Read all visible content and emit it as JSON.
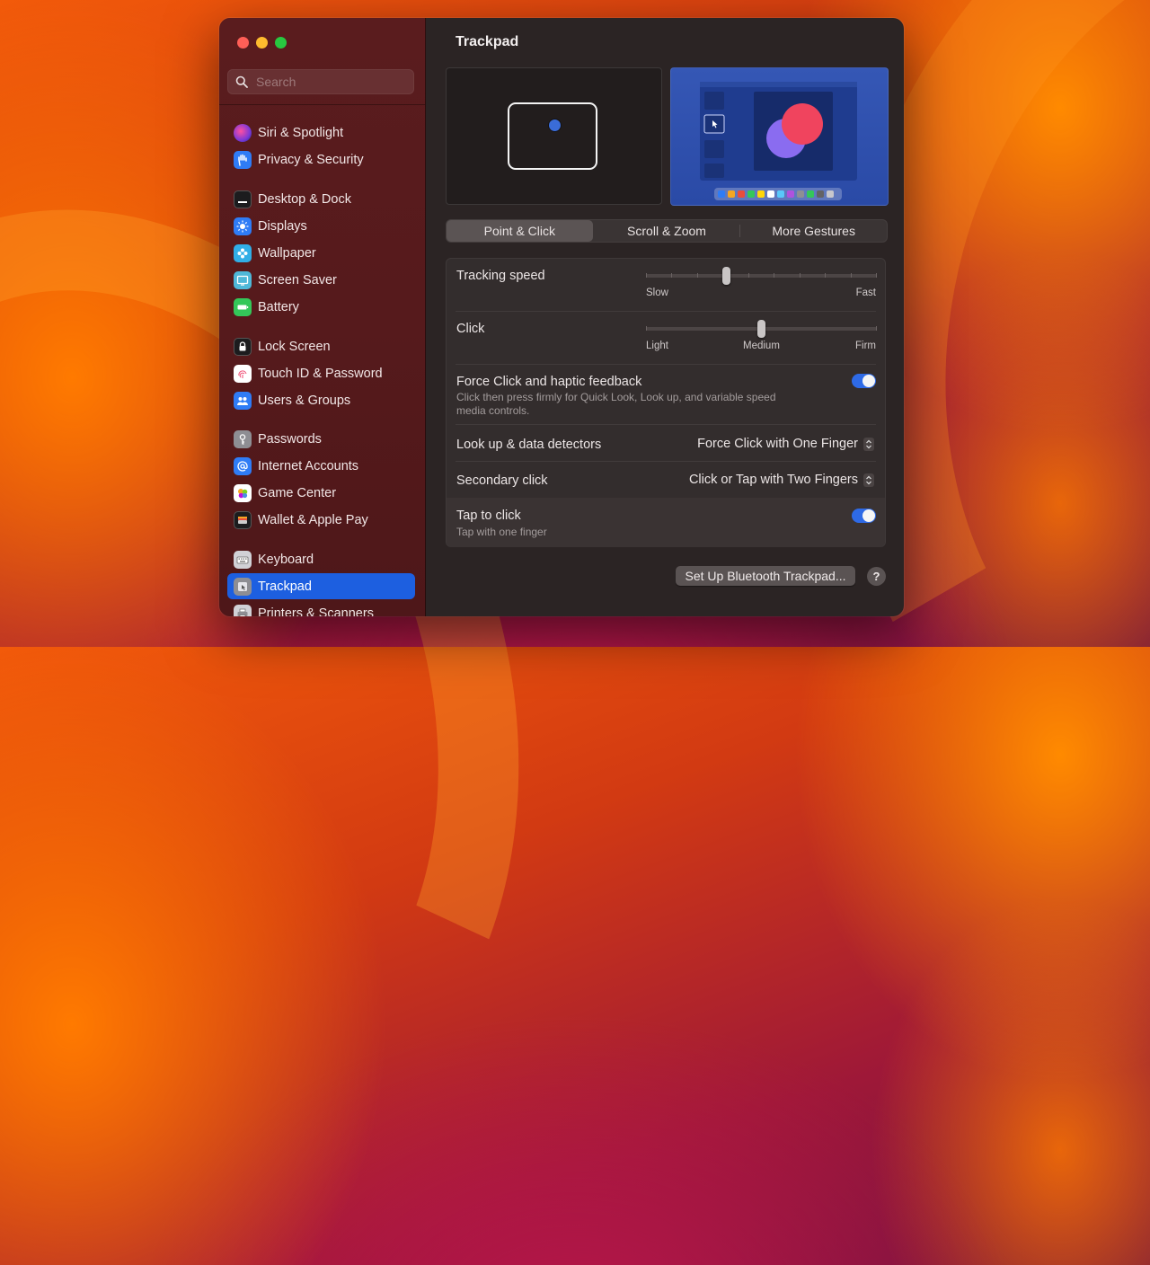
{
  "window": {
    "title": "Trackpad"
  },
  "search": {
    "placeholder": "Search"
  },
  "sidebar": {
    "items": [
      {
        "label": "Siri & Spotlight",
        "icon": "siri-icon",
        "color": "#8a3ab9"
      },
      {
        "label": "Privacy & Security",
        "icon": "hand-icon",
        "color": "#2f7cf6"
      },
      {
        "label": "Desktop & Dock",
        "icon": "dock-icon",
        "color": "#1c1c1e"
      },
      {
        "label": "Displays",
        "icon": "sun-icon",
        "color": "#2f7cf6"
      },
      {
        "label": "Wallpaper",
        "icon": "flower-icon",
        "color": "#31aee6"
      },
      {
        "label": "Screen Saver",
        "icon": "screensaver-icon",
        "color": "#4fb8d8"
      },
      {
        "label": "Battery",
        "icon": "battery-icon",
        "color": "#34c759"
      },
      {
        "label": "Lock Screen",
        "icon": "lock-icon",
        "color": "#1c1c1e"
      },
      {
        "label": "Touch ID & Password",
        "icon": "fingerprint-icon",
        "color": "#f05a7e"
      },
      {
        "label": "Users & Groups",
        "icon": "users-icon",
        "color": "#2f7cf6"
      },
      {
        "label": "Passwords",
        "icon": "key-icon",
        "color": "#8e8e93"
      },
      {
        "label": "Internet Accounts",
        "icon": "at-icon",
        "color": "#2f7cf6"
      },
      {
        "label": "Game Center",
        "icon": "game-center-icon",
        "color": "#ffffff"
      },
      {
        "label": "Wallet & Apple Pay",
        "icon": "wallet-icon",
        "color": "#1c1c1e"
      },
      {
        "label": "Keyboard",
        "icon": "keyboard-icon",
        "color": "#b0b0b5"
      },
      {
        "label": "Trackpad",
        "icon": "trackpad-icon",
        "color": "#8e8e93",
        "active": true
      },
      {
        "label": "Printers & Scanners",
        "icon": "printer-icon",
        "color": "#b0b0b5"
      }
    ]
  },
  "tabs": [
    {
      "label": "Point & Click",
      "active": true
    },
    {
      "label": "Scroll & Zoom"
    },
    {
      "label": "More Gestures"
    }
  ],
  "settings": {
    "tracking_speed": {
      "label": "Tracking speed",
      "min_label": "Slow",
      "max_label": "Fast",
      "value": 0.35
    },
    "click": {
      "label": "Click",
      "left_label": "Light",
      "mid_label": "Medium",
      "right_label": "Firm",
      "value": 0.5
    },
    "force_click": {
      "label": "Force Click and haptic feedback",
      "description": "Click then press firmly for Quick Look, Look up, and variable speed media controls.",
      "enabled": true
    },
    "look_up": {
      "label": "Look up & data detectors",
      "value": "Force Click with One Finger"
    },
    "secondary_click": {
      "label": "Secondary click",
      "value": "Click or Tap with Two Fingers"
    },
    "tap_to_click": {
      "label": "Tap to click",
      "description": "Tap with one finger",
      "enabled": true
    }
  },
  "footer": {
    "bluetooth_button": "Set Up Bluetooth Trackpad...",
    "help_button": "?"
  },
  "colors": {
    "accent": "#1d5fe0",
    "toggle_on": "#2e6ae6"
  }
}
